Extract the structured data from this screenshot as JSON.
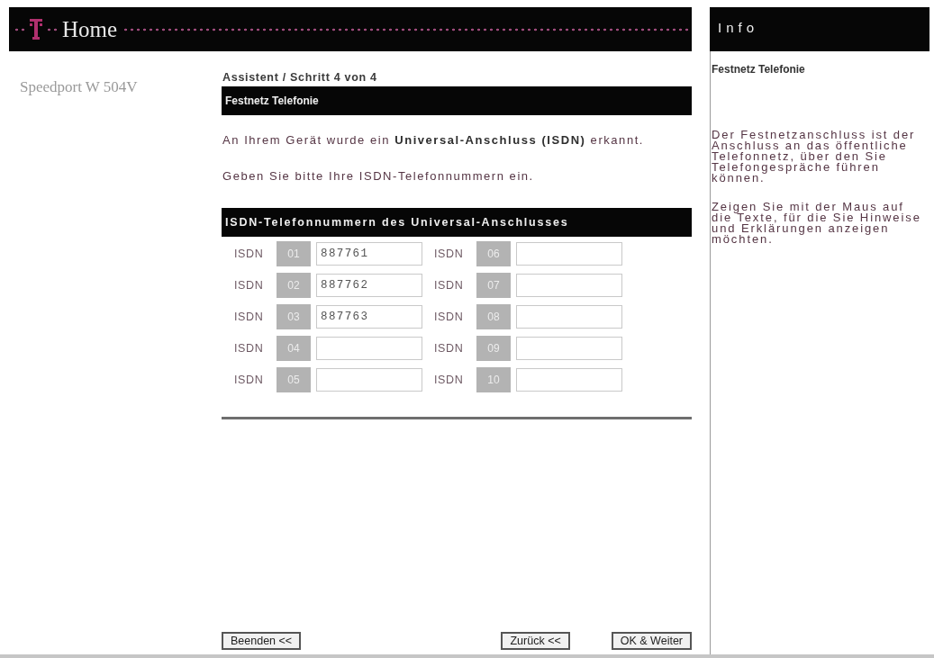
{
  "header": {
    "title": "Home"
  },
  "device": {
    "name": "Speedport W 504V"
  },
  "wizard": {
    "step": "Assistent / Schritt 4 von 4",
    "section_title": "Festnetz Telefonie",
    "paragraphs": [
      "An Ihrem Gerät wurde ein **Universal-Anschluss (ISDN)** erkannt.",
      "Geben Sie bitte Ihre ISDN-Telefonnummern ein."
    ],
    "group_title": "ISDN-Telefonnummern des Universal-Anschlusses",
    "fields": [
      {
        "label": "ISDN",
        "number": "01",
        "value": "887761"
      },
      {
        "label": "ISDN",
        "number": "02",
        "value": "887762"
      },
      {
        "label": "ISDN",
        "number": "03",
        "value": "887763"
      },
      {
        "label": "ISDN",
        "number": "04"
      },
      {
        "label": "ISDN",
        "number": "05"
      },
      {
        "label": "ISDN",
        "number": "06"
      },
      {
        "label": "ISDN",
        "number": "07"
      },
      {
        "label": "ISDN",
        "number": "08"
      },
      {
        "label": "ISDN",
        "number": "09"
      },
      {
        "label": "ISDN",
        "number": "10"
      }
    ]
  },
  "buttons": {
    "start": [
      "Beenden <<"
    ],
    "end": [
      "Zurück <<",
      "OK & Weiter"
    ]
  },
  "info": {
    "title": "Info",
    "heading": "Festnetz Telefonie",
    "paragraphs": [
      "Der Festnetzanschluss ist der Anschluss an das öffentliche Telefonnetz, über den Sie Telefongespräche führen können.",
      "Zeigen Sie mit der Maus auf die Texte, für die Sie Hinweise und Erklärungen anzeigen möchten."
    ]
  }
}
